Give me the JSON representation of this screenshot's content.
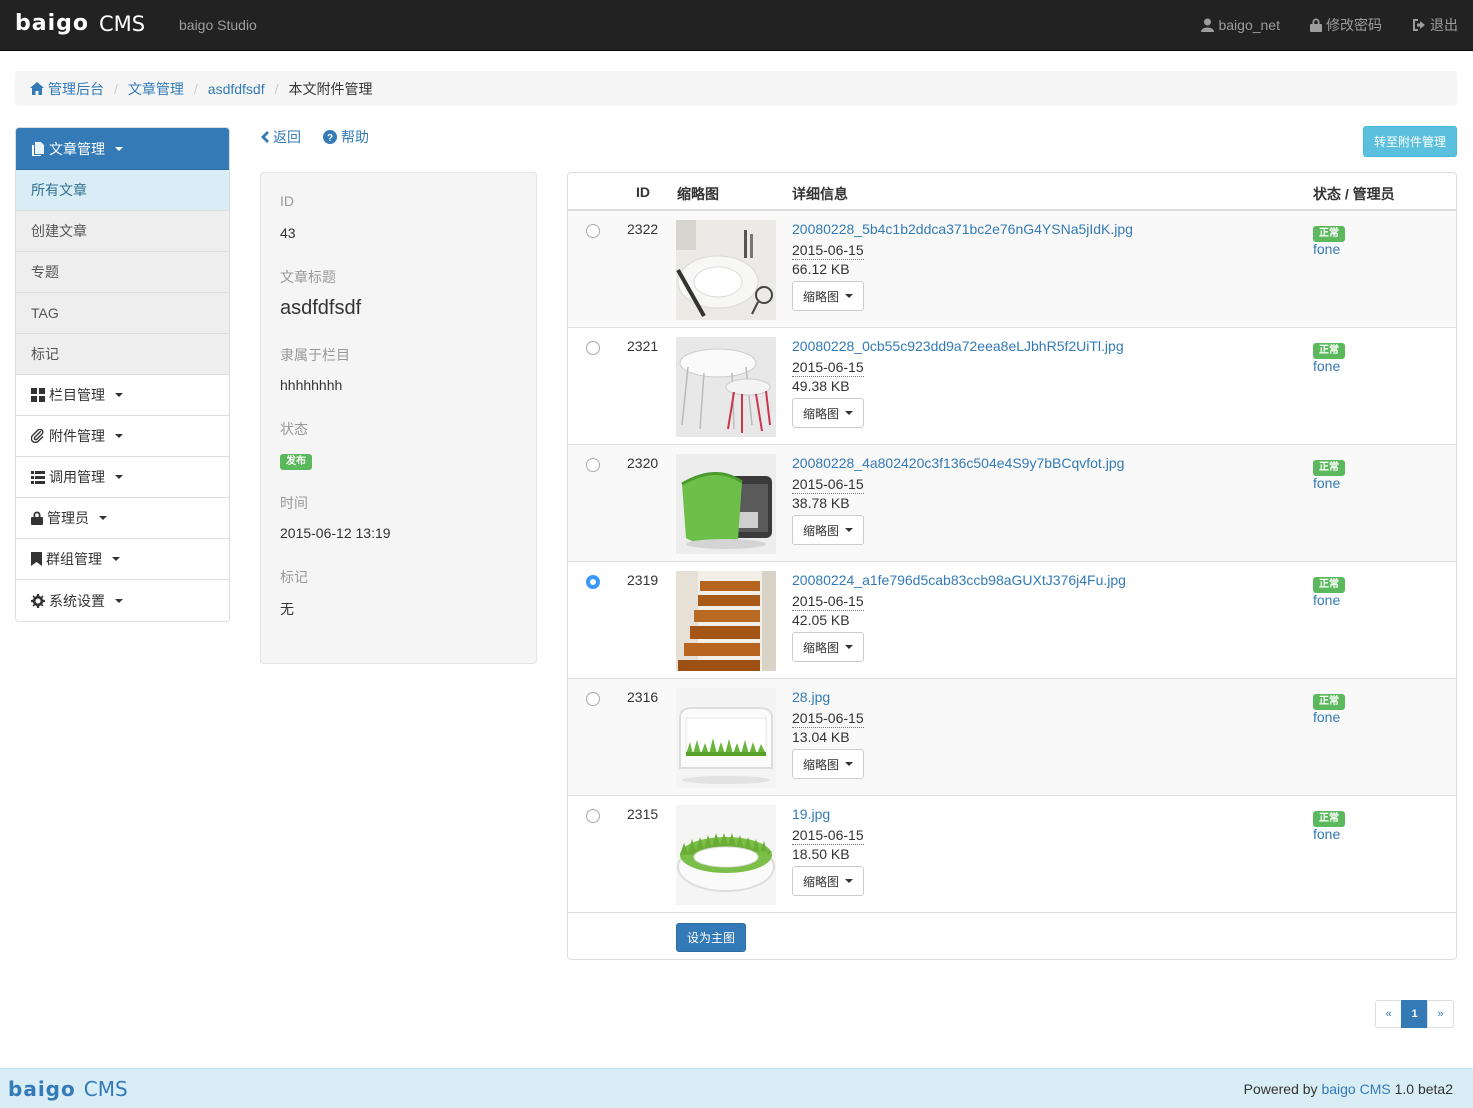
{
  "navbar": {
    "logo_word": "baigo",
    "logo_cms": "CMS",
    "studio": "baigo Studio",
    "user": "baigo_net",
    "change_password": "修改密码",
    "logout": "退出"
  },
  "breadcrumb": {
    "home": "管理后台",
    "articles": "文章管理",
    "article": "asdfdfsdf",
    "current": "本文附件管理"
  },
  "sidebar": {
    "head": "文章管理",
    "sub_items": [
      "所有文章",
      "创建文章",
      "专题",
      "TAG",
      "标记"
    ],
    "items": [
      {
        "label": "栏目管理",
        "icon": "th-large-icon"
      },
      {
        "label": "附件管理",
        "icon": "paperclip-icon"
      },
      {
        "label": "调用管理",
        "icon": "list-icon"
      },
      {
        "label": "管理员",
        "icon": "lock-icon"
      },
      {
        "label": "群组管理",
        "icon": "bookmark-icon"
      },
      {
        "label": "系统设置",
        "icon": "cog-icon"
      }
    ]
  },
  "toolbar": {
    "back": "返回",
    "help": "帮助",
    "goto_attach": "转至附件管理"
  },
  "info": {
    "id_label": "ID",
    "id_value": "43",
    "title_label": "文章标题",
    "title_value": "asdfdfsdf",
    "cat_label": "隶属于栏目",
    "cat_value": "hhhhhhhh",
    "status_label": "状态",
    "status_value": "发布",
    "time_label": "时间",
    "time_value": "2015-06-12 13:19",
    "mark_label": "标记",
    "mark_value": "无"
  },
  "table": {
    "headers": {
      "id": "ID",
      "thumb": "缩略图",
      "detail": "详细信息",
      "status": "状态 / 管理员"
    },
    "rows": [
      {
        "id": "2322",
        "name": "20080228_5b4c1b2ddca371bc2e76nG4YSNa5jIdK.jpg",
        "date": "2015-06-15",
        "size": "66.12 KB",
        "thumb_btn": "缩略图",
        "status": "正常",
        "admin": "fone",
        "checked": false
      },
      {
        "id": "2321",
        "name": "20080228_0cb55c923dd9a72eea8eLJbhR5f2UiTl.jpg",
        "date": "2015-06-15",
        "size": "49.38 KB",
        "thumb_btn": "缩略图",
        "status": "正常",
        "admin": "fone",
        "checked": false
      },
      {
        "id": "2320",
        "name": "20080228_4a802420c3f136c504e4S9y7bBCqvfot.jpg",
        "date": "2015-06-15",
        "size": "38.78 KB",
        "thumb_btn": "缩略图",
        "status": "正常",
        "admin": "fone",
        "checked": false
      },
      {
        "id": "2319",
        "name": "20080224_a1fe796d5cab83ccb98aGUXtJ376j4Fu.jpg",
        "date": "2015-06-15",
        "size": "42.05 KB",
        "thumb_btn": "缩略图",
        "status": "正常",
        "admin": "fone",
        "checked": true
      },
      {
        "id": "2316",
        "name": "28.jpg",
        "date": "2015-06-15",
        "size": "13.04 KB",
        "thumb_btn": "缩略图",
        "status": "正常",
        "admin": "fone",
        "checked": false
      },
      {
        "id": "2315",
        "name": "19.jpg",
        "date": "2015-06-15",
        "size": "18.50 KB",
        "thumb_btn": "缩略图",
        "status": "正常",
        "admin": "fone",
        "checked": false
      }
    ],
    "set_main": "设为主图"
  },
  "pagination": {
    "prev": "«",
    "current": "1",
    "next": "»"
  },
  "footer": {
    "logo_word": "baigo",
    "logo_cms": "CMS",
    "powered_prefix": "Powered by",
    "powered_link": "baigo CMS",
    "powered_version": "1.0 beta2"
  },
  "colors": {
    "primary": "#337ab7",
    "info": "#5bc0de",
    "success": "#5cb85c",
    "navbar": "#222222"
  }
}
